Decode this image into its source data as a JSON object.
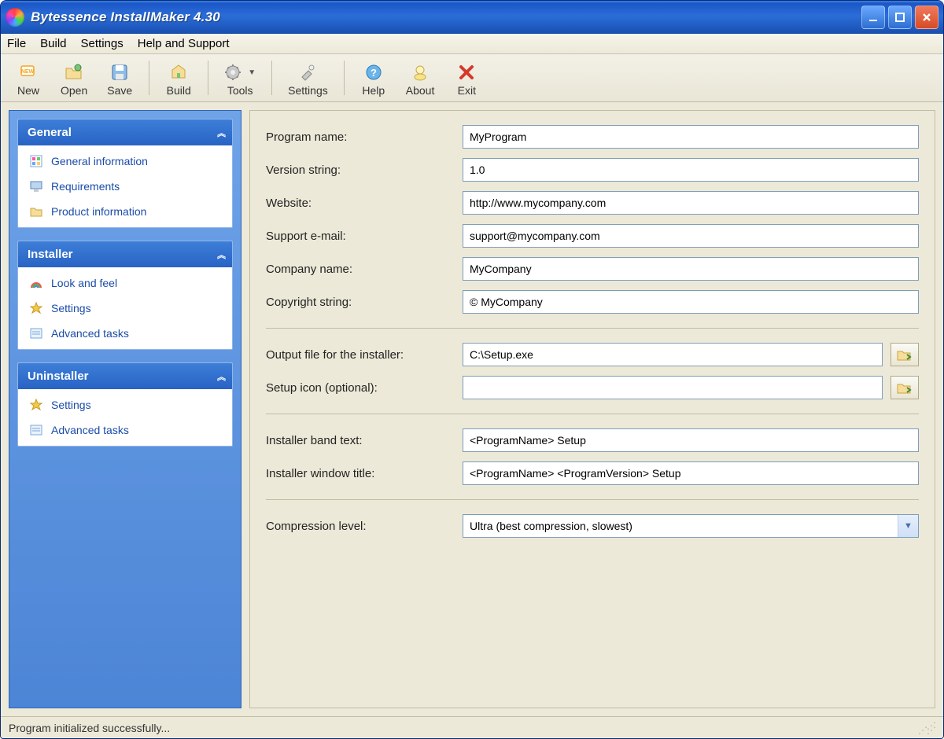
{
  "title": "Bytessence InstallMaker 4.30",
  "menu": {
    "file": "File",
    "build": "Build",
    "settings": "Settings",
    "help": "Help and Support"
  },
  "toolbar": {
    "new": "New",
    "open": "Open",
    "save": "Save",
    "build": "Build",
    "tools": "Tools",
    "settings": "Settings",
    "help": "Help",
    "about": "About",
    "exit": "Exit"
  },
  "sidebar": {
    "general": {
      "title": "General",
      "items": [
        {
          "label": "General information"
        },
        {
          "label": "Requirements"
        },
        {
          "label": "Product information"
        }
      ]
    },
    "installer": {
      "title": "Installer",
      "items": [
        {
          "label": "Look and feel"
        },
        {
          "label": "Settings"
        },
        {
          "label": "Advanced tasks"
        }
      ]
    },
    "uninstaller": {
      "title": "Uninstaller",
      "items": [
        {
          "label": "Settings"
        },
        {
          "label": "Advanced tasks"
        }
      ]
    }
  },
  "form": {
    "program_name": {
      "label": "Program name:",
      "value": "MyProgram"
    },
    "version": {
      "label": "Version string:",
      "value": "1.0"
    },
    "website": {
      "label": "Website:",
      "value": "http://www.mycompany.com"
    },
    "support_email": {
      "label": "Support e-mail:",
      "value": "support@mycompany.com"
    },
    "company": {
      "label": "Company name:",
      "value": "MyCompany"
    },
    "copyright": {
      "label": "Copyright string:",
      "value": "© MyCompany"
    },
    "output_file": {
      "label": "Output file for the installer:",
      "value": "C:\\Setup.exe"
    },
    "setup_icon": {
      "label": "Setup icon (optional):",
      "value": ""
    },
    "band_text": {
      "label": "Installer band text:",
      "value": "<ProgramName> Setup"
    },
    "window_title": {
      "label": "Installer window title:",
      "value": "<ProgramName> <ProgramVersion> Setup"
    },
    "compression": {
      "label": "Compression level:",
      "value": "Ultra (best compression, slowest)"
    }
  },
  "status": "Program initialized successfully..."
}
